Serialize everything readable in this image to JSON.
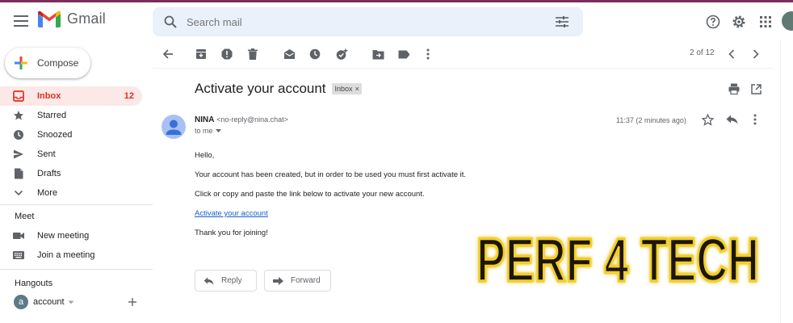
{
  "app": {
    "name": "Gmail"
  },
  "search": {
    "placeholder": "Search mail"
  },
  "compose": {
    "label": "Compose"
  },
  "sidebar": {
    "items": [
      {
        "label": "Inbox",
        "count": "12"
      },
      {
        "label": "Starred"
      },
      {
        "label": "Snoozed"
      },
      {
        "label": "Sent"
      },
      {
        "label": "Drafts"
      },
      {
        "label": "More"
      }
    ],
    "meet": {
      "title": "Meet",
      "items": [
        {
          "label": "New meeting"
        },
        {
          "label": "Join a meeting"
        }
      ]
    },
    "hangouts": {
      "title": "Hangouts",
      "avatar_letter": "a",
      "account_label": "account"
    }
  },
  "toolbar": {
    "pager": "2 of 12"
  },
  "message": {
    "subject": "Activate your account",
    "label_chip": "Inbox",
    "sender_name": "NINA",
    "sender_email": "<no-reply@nina.chat>",
    "to": "to me",
    "time": "11:37 (2 minutes ago)",
    "body": {
      "greeting": "Hello,",
      "line1": "Your account has been created, but in order to be used you must first activate it.",
      "line2": "Click or copy and paste the link below to activate your new account.",
      "link": "Activate your account",
      "closing": "Thank you for joining!"
    },
    "reply_label": "Reply",
    "forward_label": "Forward"
  },
  "watermark": {
    "text": "PERF 4 TECH"
  },
  "colors": {
    "accent_red": "#d93025",
    "active_bg": "#fce8e6",
    "search_bg": "#eaf1fb",
    "link": "#1a5fc6",
    "watermark_gold": "#e8c21c"
  }
}
